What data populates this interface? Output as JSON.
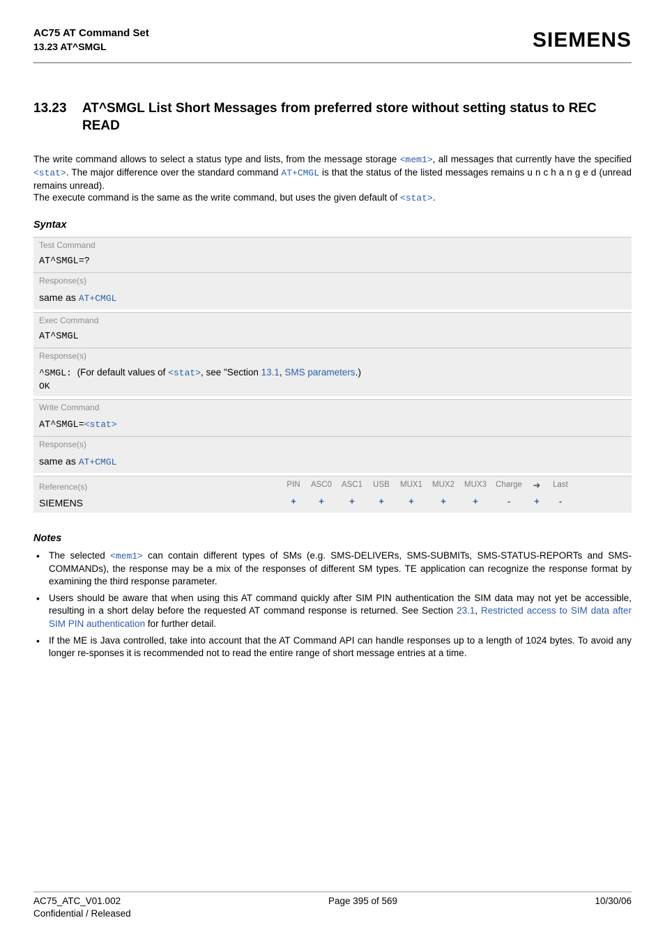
{
  "header": {
    "product": "AC75 AT Command Set",
    "section_ref": "13.23 AT^SMGL",
    "brand": "SIEMENS"
  },
  "title": {
    "number": "13.23",
    "text": "AT^SMGL   List Short Messages from preferred store without setting status to REC READ"
  },
  "intro": {
    "pre1": "The write command allows to select a status type and lists, from the message storage ",
    "mem1": "<mem1>",
    "post1": ", all messages that currently have the specified ",
    "stat1": "<stat>",
    "post2": ". The major difference over the standard command ",
    "atcmgl": "AT+CMGL",
    "post3": " is that the status of the listed messages remains u n c h a n g e d (unread remains unread).",
    "line2a": "The execute command is the same as the write command, but uses the given default of ",
    "stat2": "<stat>",
    "line2b": "."
  },
  "syntax_label": "Syntax",
  "blocks": {
    "test_label": "Test Command",
    "test_cmd": "AT^SMGL=?",
    "resp_label": "Response(s)",
    "same_as_pre": "same as ",
    "same_as_link": "AT+CMGL",
    "exec_label": "Exec Command",
    "exec_cmd": "AT^SMGL",
    "exec_resp_pre": "^SMGL: ",
    "exec_resp_mid1": "(For default values of ",
    "exec_resp_stat": "<stat>",
    "exec_resp_mid2": ", see \"Section ",
    "exec_resp_secnum": "13.1",
    "exec_resp_sep": ", ",
    "exec_resp_link": "SMS parameters",
    "exec_resp_end": ".)",
    "ok": "OK",
    "write_label": "Write Command",
    "write_cmd_pre": "AT^SMGL=",
    "write_cmd_stat": "<stat>",
    "ref_label": "Reference(s)",
    "ref_name": "SIEMENS"
  },
  "grid": {
    "headers": [
      "PIN",
      "ASC0",
      "ASC1",
      "USB",
      "MUX1",
      "MUX2",
      "MUX3",
      "Charge",
      "➜",
      "Last"
    ],
    "values": [
      "+",
      "+",
      "+",
      "+",
      "+",
      "+",
      "+",
      "-",
      "+",
      "-"
    ]
  },
  "notes_label": "Notes",
  "notes": {
    "n1a": "The selected ",
    "n1_mem": "<mem1>",
    "n1b": " can contain different types of SMs (e.g. SMS-DELIVERs, SMS-SUBMITs, SMS-STATUS-REPORTs and SMS-COMMANDs), the response may be a mix of the responses of different SM types. TE application can recognize the response format by examining the third response parameter.",
    "n2a": "Users should be aware that when using this AT command quickly after SIM PIN authentication the SIM data may not yet be accessible, resulting in a short delay before the requested AT command response is returned. See Section ",
    "n2_sec": "23.1",
    "n2_sep": ", ",
    "n2_link": "Restricted access to SIM data after SIM PIN authentication",
    "n2b": " for further detail.",
    "n3": "If the ME is Java controlled, take into account that the AT Command API can handle responses up to a length of 1024 bytes. To avoid any longer re-sponses it is recommended not to read the entire range of short message entries at a time."
  },
  "footer": {
    "left1": "AC75_ATC_V01.002",
    "left2": "Confidential / Released",
    "center": "Page 395 of 569",
    "right": "10/30/06"
  }
}
